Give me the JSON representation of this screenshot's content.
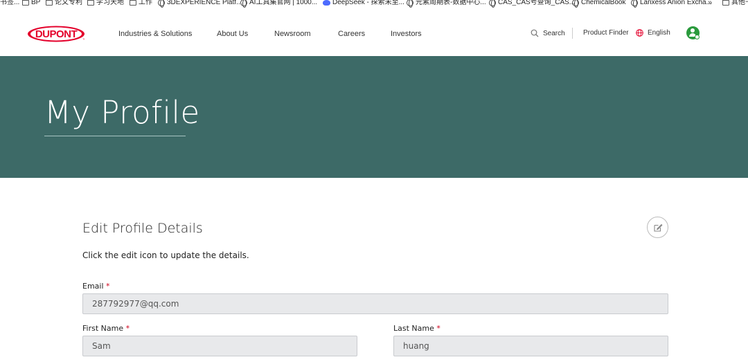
{
  "bookmarks": [
    {
      "label": "书签...",
      "icon": "none"
    },
    {
      "label": "BP",
      "icon": "folder-icon"
    },
    {
      "label": "论文专利",
      "icon": "folder-icon"
    },
    {
      "label": "学习天地",
      "icon": "folder-icon"
    },
    {
      "label": "工作",
      "icon": "folder-icon"
    },
    {
      "label": "3DEXPERIENCE Platf...",
      "icon": "globe-icon"
    },
    {
      "label": "AI工具集官网 | 1000...",
      "icon": "globe-icon"
    },
    {
      "label": "DeepSeek - 探索未至...",
      "icon": "deepseek-icon"
    },
    {
      "label": "元素周期表-数据中心...",
      "icon": "globe-icon"
    },
    {
      "label": "CAS_CAS号查询_CAS...",
      "icon": "globe-icon"
    },
    {
      "label": "ChemicalBook",
      "icon": "globe-icon"
    },
    {
      "label": "Lanxess Anion Excha...",
      "icon": "globe-icon"
    },
    {
      "label": "其他书",
      "icon": "folder-icon"
    }
  ],
  "more_bookmarks": "»",
  "header": {
    "brand": "DUPONT",
    "trademark": "™",
    "nav": [
      "Industries & Solutions",
      "About Us",
      "Newsroom",
      "Careers",
      "Investors"
    ],
    "search_label": "Search",
    "product_finder": "Product Finder",
    "language": "English"
  },
  "banner": {
    "title": "My Profile"
  },
  "profile": {
    "section_title": "Edit Profile Details",
    "helper_text": "Click the edit icon to update the details.",
    "required_mark": "*",
    "email_label": "Email",
    "email_value": "287792977@qq.com",
    "first_name_label": "First Name",
    "first_name_value": "Sam",
    "last_name_label": "Last Name",
    "last_name_value": "huang"
  },
  "colors": {
    "banner_bg": "#3d6a67",
    "brand_red": "#e4002b",
    "required_red": "#d0021b",
    "avatar_green": "#2a9a3c",
    "field_bg": "#e8e9eb"
  }
}
